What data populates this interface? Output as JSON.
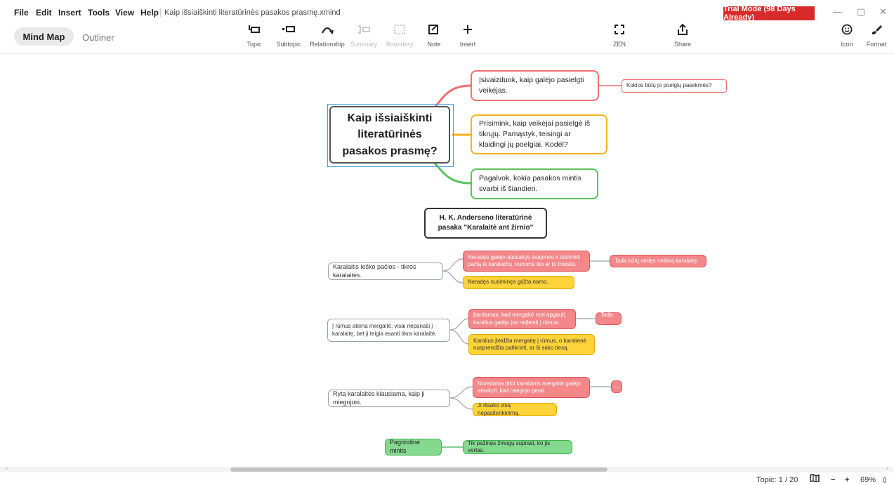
{
  "menu": {
    "file": "File",
    "edit": "Edit",
    "insert": "Insert",
    "tools": "Tools",
    "view": "View",
    "help": "Help"
  },
  "filename": "Kaip išsiaiškinti literatūrinės pasakos prasmę.xmind",
  "trial": "Trial Mode (98 Days Already)",
  "window_controls": {
    "minimize": "—",
    "restore": "▢",
    "close": "✕"
  },
  "tabs": {
    "mindmap": "Mind Map",
    "outliner": "Outliner"
  },
  "toolbar": {
    "topic": "Topic",
    "subtopic": "Subtopic",
    "relationship": "Relationship",
    "summary": "Summary",
    "boundary": "Boundary",
    "note": "Note",
    "insert": "Insert",
    "zen": "ZEN",
    "share": "Share",
    "icon": "Icon",
    "format": "Format"
  },
  "icons": {
    "topic": "topic-icon",
    "subtopic": "subtopic-icon",
    "relationship": "relationship-icon",
    "summary": "summary-icon",
    "boundary": "boundary-icon",
    "note": "note-icon",
    "insert": "plus-icon",
    "zen": "zen-icon",
    "share": "share-icon",
    "icon": "smiley-icon",
    "format": "brush-icon",
    "map": "map-icon"
  },
  "map": {
    "central": "Kaip išsiaiškinti literatūrinės pasakos prasmę?",
    "branch1": "Įsivaizduok, kaip galėjo pasielgti veikėjas.",
    "branch1_sub": "Kokios būtų jo poelgių pasekmės?",
    "branch2": "Prisimink, kaip veikėjai pasielgė iš tikrųjų. Pamąstyk, teisingi ar klaidingi jų poelgiai. Kodėl?",
    "branch3": "Pagalvok, kokia pasakos mintis svarbi iš šiandien.",
    "floating": "H. K. Anderseno literatūrinė pasaka \"Karalaitė ant žirnio\"",
    "g1_root": "Karalaitis ieško pačios - tikros karalaitės.",
    "g1_red": "Neradęs galėjo atsisakyti svajonės ir išsirinkti pačią iš karalaičių, kurioms šio ar to trūksta.",
    "g1_red_sub": "Tada būtų vedęs netikrą karalaitę.",
    "g1_yellow": "Neradęs nusiminęs grįžta namo.",
    "g2_root": "Į rūmus ateina mergaitė, visai nepanaši į karalaitę, bet ji teigia esanti tikra karalaitė.",
    "g2_red": "Įtardamas, kad mergaitė nori apgauti, karalius galėjo jos neįleisti į rūmus.",
    "g2_red_sub": "Tada ...",
    "g2_yellow": "Karalius įleidžia mergaitę į rūmus, o karalienė nusprendžia patikrinti, ar ši sako tiesą.",
    "g3_root": "Rytą karalaitės klausiama, kaip ji miegojusi.",
    "g3_red": "Norėdama įtikti karaliams mergaitė galėjo atsakyti, kad miegojo gerai.",
    "g3_red_sub": "...",
    "g3_yellow": "Ji išsako visą nepasitenkinimą.",
    "g4_root": "Pagrindinė mintis",
    "g4_sub": "Tik pažinęs žmogų suprasi, ko jis vertas."
  },
  "colors": {
    "branch_red": "#f07070",
    "branch_yellow": "#f5b21c",
    "branch_green": "#5cc25c",
    "trial": "#d92b2b"
  },
  "status": {
    "topic": "Topic: 1 / 20",
    "zoom_minus": "−",
    "zoom_plus": "+",
    "zoom": "69%"
  }
}
